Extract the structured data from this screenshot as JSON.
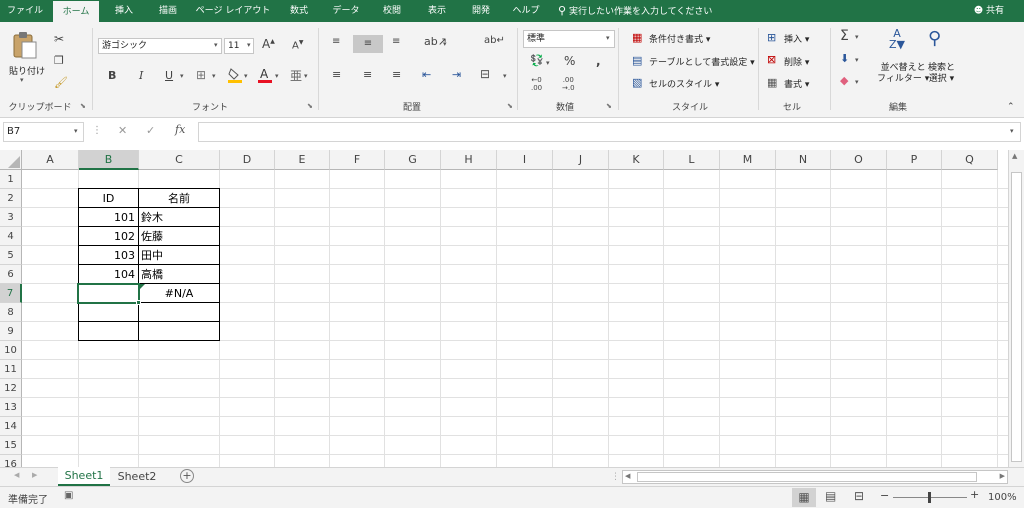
{
  "tabs": [
    "ファイル",
    "ホーム",
    "挿入",
    "描画",
    "ページ レイアウト",
    "数式",
    "データ",
    "校閲",
    "表示",
    "開発",
    "ヘルプ"
  ],
  "tell_me": "実行したい作業を入力してください",
  "share": "共有",
  "clipboard": {
    "paste": "貼り付け",
    "label": "クリップボード"
  },
  "font": {
    "name": "游ゴシック",
    "size": "11",
    "label": "フォント",
    "color_accent": "#e81123",
    "fill_accent": "#ffc000"
  },
  "alignment": {
    "label": "配置"
  },
  "number": {
    "format": "標準",
    "label": "数値"
  },
  "styles": {
    "conditional": "条件付き書式",
    "table": "テーブルとして書式設定",
    "cell": "セルのスタイル",
    "label": "スタイル"
  },
  "cells": {
    "insert": "挿入",
    "delete": "削除",
    "format": "書式",
    "label": "セル"
  },
  "editing": {
    "sort": "並べ替えと",
    "sort2": "フィルター",
    "find": "検索と",
    "find2": "選択",
    "label": "編集"
  },
  "formula_bar": {
    "name_box": "B7",
    "fx": "fx",
    "value": ""
  },
  "columns": [
    "A",
    "B",
    "C",
    "D",
    "E",
    "F",
    "G",
    "H",
    "I",
    "J",
    "K",
    "L",
    "M",
    "N",
    "O",
    "P",
    "Q"
  ],
  "rows": [
    "1",
    "2",
    "3",
    "4",
    "5",
    "6",
    "7",
    "8",
    "9",
    "10",
    "11",
    "12",
    "13",
    "14",
    "15",
    "16"
  ],
  "table": {
    "header_id": "ID",
    "header_name": "名前",
    "rows": [
      {
        "id": "101",
        "name": "鈴木"
      },
      {
        "id": "102",
        "name": "佐藤"
      },
      {
        "id": "103",
        "name": "田中"
      },
      {
        "id": "104",
        "name": "高橋"
      }
    ],
    "c7": "#N/A"
  },
  "selected_cell": "B7",
  "sheets": [
    "Sheet1",
    "Sheet2"
  ],
  "active_sheet": "Sheet1",
  "status": {
    "ready": "準備完了",
    "zoom": "100%"
  },
  "colors": {
    "excel_green": "#217346"
  }
}
